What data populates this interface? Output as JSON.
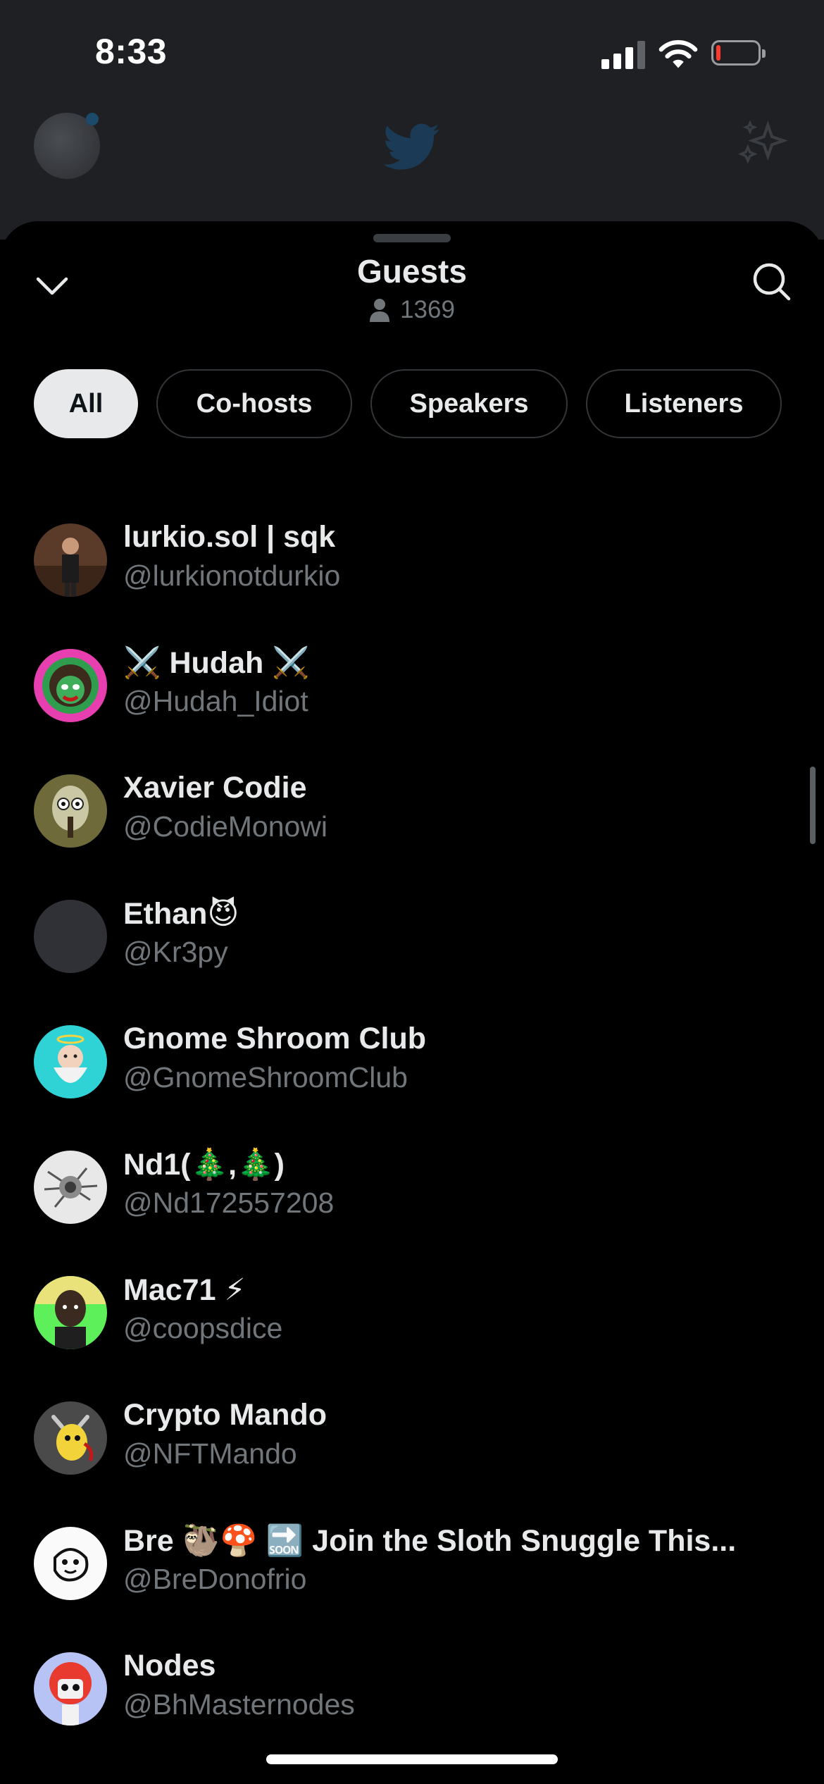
{
  "status_bar": {
    "time": "8:33"
  },
  "colors": {
    "background": "#000000",
    "sheet": "#000000",
    "text_primary": "#e7e9ea",
    "text_secondary": "#71767b",
    "chip_border": "#333639",
    "chip_active_bg": "#e7e9ea",
    "battery_low": "#ff3b30"
  },
  "sheet": {
    "title": "Guests",
    "count": "1369",
    "icons": {
      "collapse": "chevron-down-icon",
      "count": "person-icon",
      "search": "search-icon"
    }
  },
  "filters": {
    "tabs": [
      {
        "label": "All",
        "active": true
      },
      {
        "label": "Co-hosts",
        "active": false
      },
      {
        "label": "Speakers",
        "active": false
      },
      {
        "label": "Listeners",
        "active": false
      }
    ]
  },
  "guests": [
    {
      "name": "lurkio.sol | sqk",
      "handle": "@lurkionotdurkio"
    },
    {
      "name": "⚔️ Hudah ⚔️",
      "handle": "@Hudah_Idiot"
    },
    {
      "name": "Xavier Codie",
      "handle": "@CodieMonowi"
    },
    {
      "name": "Ethan😈",
      "handle": "@Kr3py"
    },
    {
      "name": "Gnome Shroom Club",
      "handle": "@GnomeShroomClub"
    },
    {
      "name": "Nd1(🎄,🎄)",
      "handle": "@Nd172557208"
    },
    {
      "name": "Mac71 ⚡",
      "handle": "@coopsdice"
    },
    {
      "name": "Crypto Mando",
      "handle": "@NFTMando"
    },
    {
      "name": "Bre 🦥🍄 🔜 Join the Sloth Snuggle This...",
      "handle": "@BreDonofrio"
    },
    {
      "name": "Nodes",
      "handle": "@BhMasternodes"
    }
  ]
}
